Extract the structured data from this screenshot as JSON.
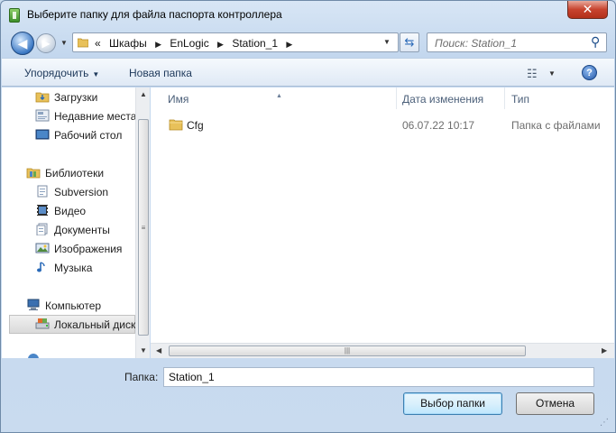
{
  "window": {
    "title": "Выберите папку для файла паспорта контроллера",
    "close_glyph": "✕"
  },
  "nav": {
    "back_glyph": "◀",
    "forward_glyph": "▶",
    "breadcrumb_prefix": "«",
    "breadcrumb": [
      "Шкафы",
      "EnLogic",
      "Station_1"
    ],
    "search_placeholder": "Поиск: Station_1"
  },
  "toolbar": {
    "organize_label": "Упорядочить",
    "new_folder_label": "Новая папка",
    "help_glyph": "?"
  },
  "sidebar": {
    "favorites": [
      {
        "label": "Загрузки",
        "icon": "downloads-icon"
      },
      {
        "label": "Недавние места",
        "icon": "recent-places-icon"
      },
      {
        "label": "Рабочий стол",
        "icon": "desktop-icon"
      }
    ],
    "libraries_header": "Библиотеки",
    "libraries": [
      {
        "label": "Subversion",
        "icon": "document-icon"
      },
      {
        "label": "Видео",
        "icon": "video-icon"
      },
      {
        "label": "Документы",
        "icon": "documents-icon"
      },
      {
        "label": "Изображения",
        "icon": "pictures-icon"
      },
      {
        "label": "Музыка",
        "icon": "music-icon"
      }
    ],
    "computer_header": "Компьютер",
    "local_disk": "Локальный диск"
  },
  "columns": {
    "name": "Имя",
    "date": "Дата изменения",
    "type": "Тип"
  },
  "files": [
    {
      "name": "Cfg",
      "date": "06.07.22 10:17",
      "type": "Папка с файлами"
    }
  ],
  "footer": {
    "folder_label": "Папка:",
    "folder_value": "Station_1",
    "select_button": "Выбор папки",
    "cancel_button": "Отмена"
  }
}
